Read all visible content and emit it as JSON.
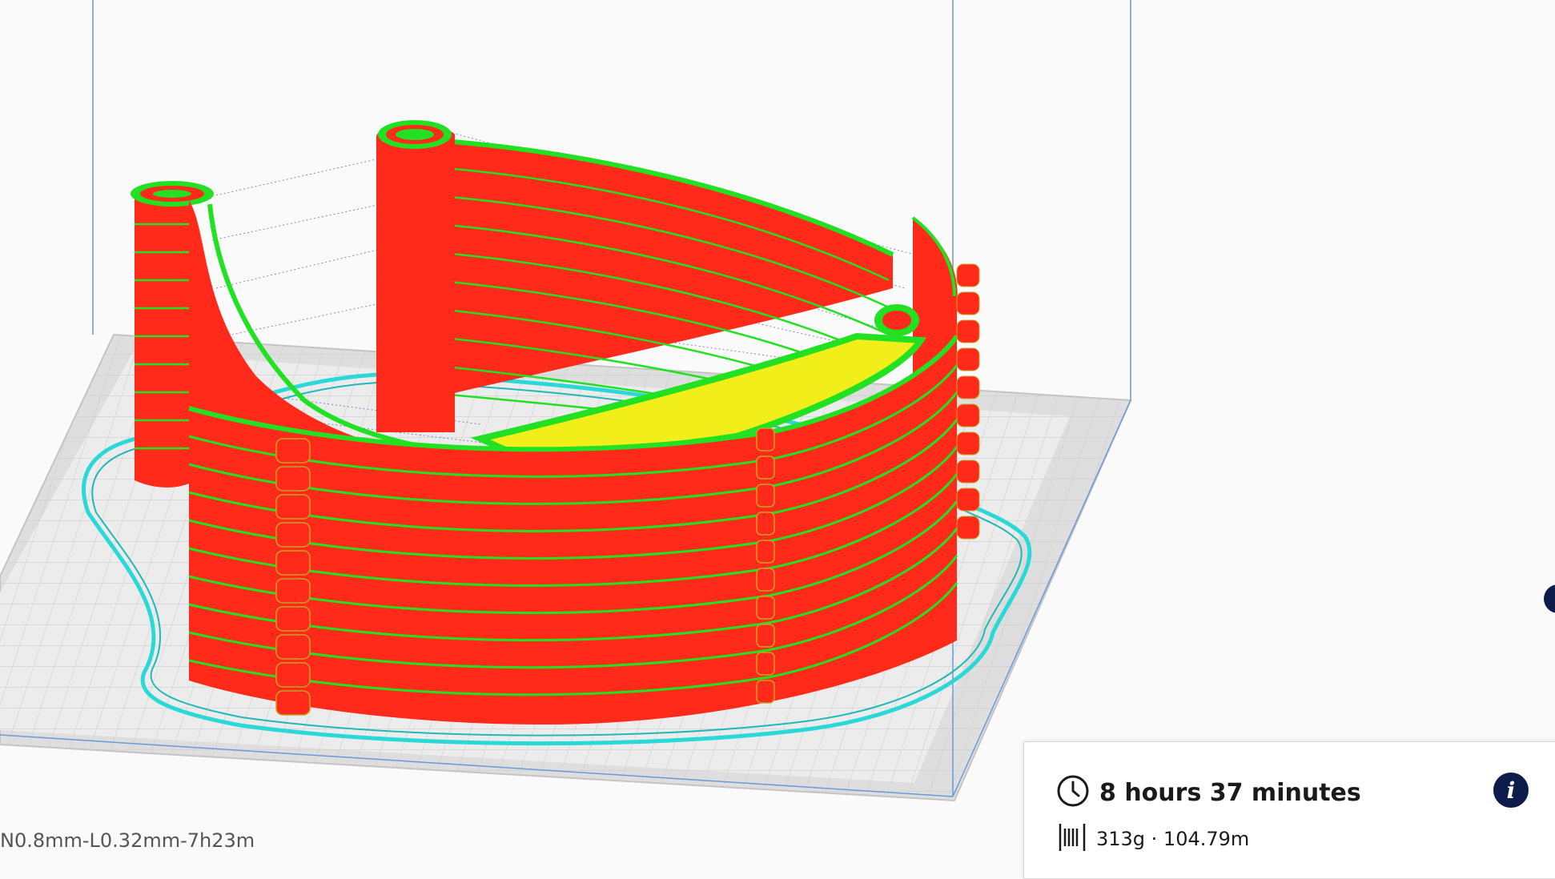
{
  "viewport": {
    "job_name": "N0.8mm-L0.32mm-7h23m",
    "colors": {
      "background": "#fafafa",
      "build_plate": "#dcdcdc",
      "build_volume_lines": "#6a9ad8",
      "wall_outer": "#ff2a1a",
      "wall_inner": "#22e022",
      "top_skin": "#f2ee1a",
      "skirt": "#2ad8d8",
      "travel_moves": "#3a3ab8"
    }
  },
  "print_info": {
    "time_icon": "clock-icon",
    "print_time": "8 hours 37 minutes",
    "material_icon": "filament-spool-icon",
    "material": "313g · 104.79m",
    "info_button_icon": "info-icon",
    "info_button_glyph": "i"
  }
}
